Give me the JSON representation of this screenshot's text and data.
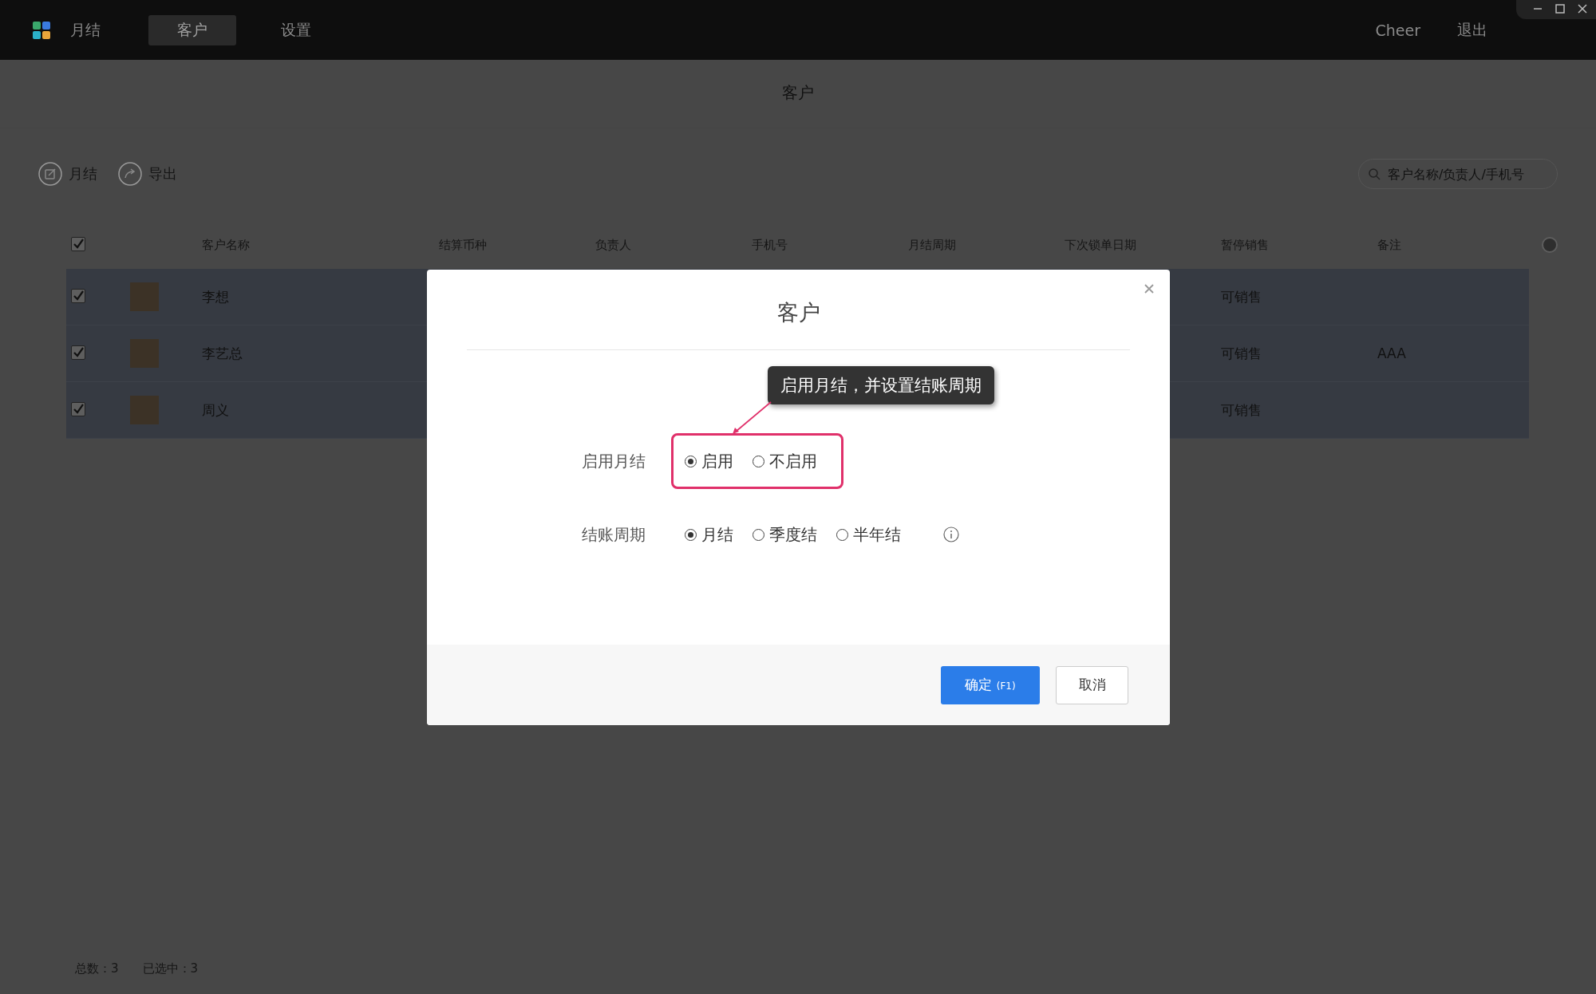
{
  "app": {
    "title": "月结",
    "nav": [
      {
        "label": "客户",
        "selected": true
      },
      {
        "label": "设置",
        "selected": false
      }
    ],
    "user": "Cheer",
    "logout": "退出"
  },
  "page": {
    "title": "客户",
    "actions": [
      {
        "label": "月结",
        "kind": "edit"
      },
      {
        "label": "导出",
        "kind": "share"
      }
    ],
    "search": {
      "placeholder": "客户名称/负责人/手机号"
    }
  },
  "table": {
    "header_checked": true,
    "columns": [
      "客户名称",
      "结算币种",
      "负责人",
      "手机号",
      "月结周期",
      "下次锁单日期",
      "暂停销售",
      "备注"
    ],
    "rows": [
      {
        "checked": true,
        "selected": true,
        "name": "李想",
        "status": "可销售"
      },
      {
        "checked": true,
        "selected": true,
        "name": "李艺总",
        "status": "可销售",
        "note": "AAA"
      },
      {
        "checked": true,
        "selected": true,
        "name": "周义",
        "status": "可销售"
      }
    ]
  },
  "footer": {
    "total_label": "总数：",
    "total": "3",
    "selected_label": "已选中：",
    "selected": "3"
  },
  "dialog": {
    "title": "客户",
    "tooltip": "启用月结，并设置结账周期",
    "fields": [
      {
        "label": "启用月结",
        "highlighted": true,
        "info": false,
        "options": [
          {
            "label": "启用",
            "selected": true
          },
          {
            "label": "不启用",
            "selected": false
          }
        ]
      },
      {
        "label": "结账周期",
        "highlighted": false,
        "info": true,
        "options": [
          {
            "label": "月结",
            "selected": true
          },
          {
            "label": "季度结",
            "selected": false
          },
          {
            "label": "半年结",
            "selected": false
          }
        ]
      }
    ],
    "buttons": [
      {
        "label": "确定",
        "shortcut": "(F1)",
        "kind": "primary"
      },
      {
        "label": "取消",
        "kind": "secondary"
      }
    ]
  }
}
